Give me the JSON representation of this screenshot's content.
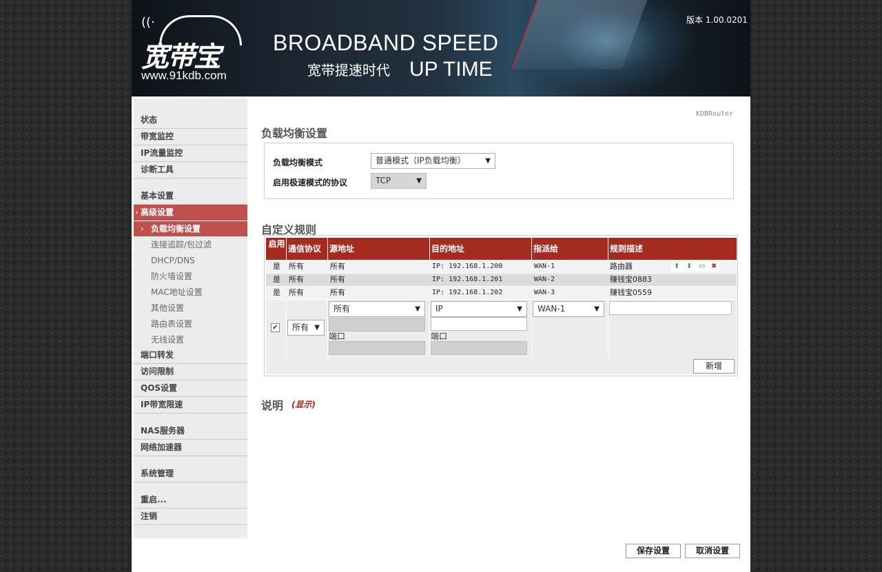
{
  "header": {
    "logo_text": "宽带宝",
    "logo_url": "www.91kdb.com",
    "slogan_line1": "BROADBAND SPEED",
    "slogan_line2_cn": "宽带提速时代",
    "slogan_line2_en": "UP TIME",
    "version": "版本 1.00.0201"
  },
  "sidebar": {
    "items": [
      {
        "label": "状态"
      },
      {
        "label": "带宽监控"
      },
      {
        "label": "IP流量监控"
      },
      {
        "label": "诊断工具"
      },
      {
        "label": "基本设置"
      },
      {
        "label": "高级设置"
      },
      {
        "label": "端口转发"
      },
      {
        "label": "访问限制"
      },
      {
        "label": "QOS设置"
      },
      {
        "label": "IP带宽限速"
      },
      {
        "label": "NAS服务器"
      },
      {
        "label": "网络加速器"
      },
      {
        "label": "系统管理"
      },
      {
        "label": "重启..."
      },
      {
        "label": "注销"
      }
    ],
    "subitems": [
      {
        "label": "负载均衡设置"
      },
      {
        "label": "连接追踪/包过滤"
      },
      {
        "label": "DHCP/DNS"
      },
      {
        "label": "防火墙设置"
      },
      {
        "label": "MAC地址设置"
      },
      {
        "label": "其他设置"
      },
      {
        "label": "路由表设置"
      },
      {
        "label": "无线设置"
      }
    ]
  },
  "main": {
    "router_name": "KDBRouter",
    "lb_title": "负载均衡设置",
    "lb_mode_label": "负载均衡模式",
    "lb_mode_value": "普通模式（IP负载均衡）",
    "fast_proto_label": "启用极速模式的协议",
    "fast_proto_value": "TCP",
    "rules_title": "自定义规则",
    "columns": [
      "启用",
      "通信协议",
      "源地址",
      "目的地址",
      "指派给",
      "规则描述"
    ],
    "rows": [
      {
        "enabled": "是",
        "protocol": "所有",
        "source": "所有",
        "dest": "IP: 192.168.1.200",
        "assign": "WAN-1",
        "desc": "路由器"
      },
      {
        "enabled": "是",
        "protocol": "所有",
        "source": "所有",
        "dest": "IP: 192.168.1.201",
        "assign": "WAN-2",
        "desc": "赚钱宝0883"
      },
      {
        "enabled": "是",
        "protocol": "所有",
        "source": "所有",
        "dest": "IP: 192.168.1.202",
        "assign": "WAN-3",
        "desc": "赚钱宝0559"
      }
    ],
    "new_rule": {
      "protocol": "所有",
      "source_type": "所有",
      "dest_type": "IP",
      "assign": "WAN-1",
      "port_label": "端口",
      "add_button": "新增"
    },
    "explain_title": "说明",
    "explain_toggle": "(显示)",
    "save_button": "保存设置",
    "cancel_button": "取消设置"
  }
}
